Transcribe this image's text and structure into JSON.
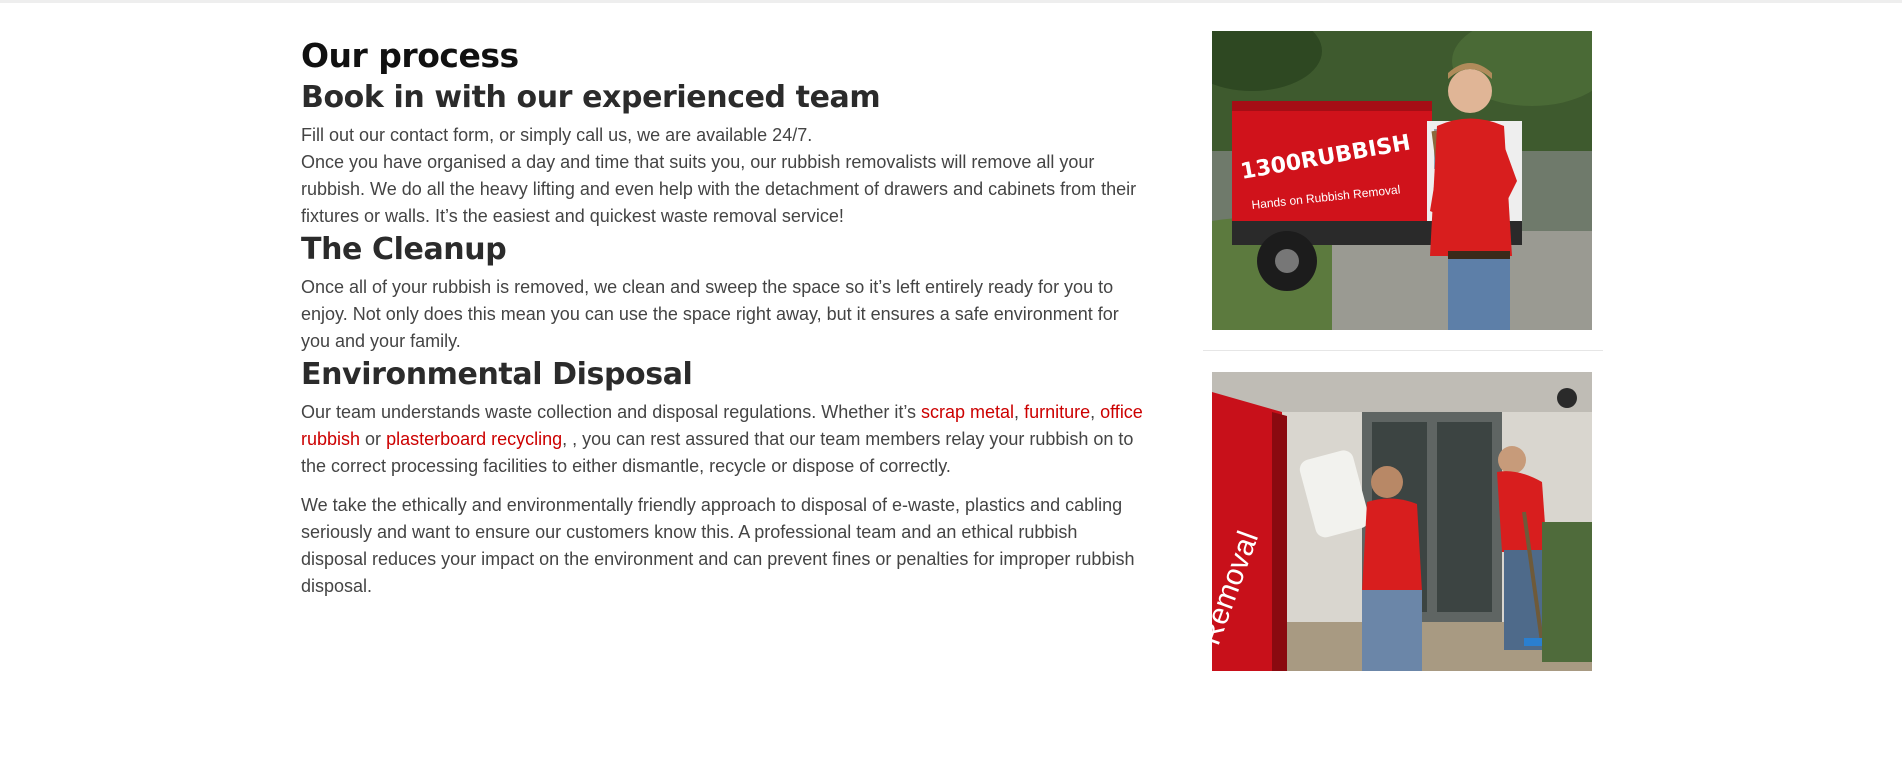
{
  "page": {
    "title": "Our process"
  },
  "sections": [
    {
      "heading": "Book in with our experienced team",
      "line1": "Fill out our contact form, or simply call us, we are available 24/7.",
      "line2": "Once you have organised a day and time that suits you, our rubbish removalists will remove all your rubbish. We do all the heavy lifting and even help with the detachment of drawers and cabinets from their fixtures or walls. It’s the easiest and quickest waste removal service!"
    },
    {
      "heading": "The Cleanup",
      "text": "Once all of your rubbish is removed, we clean and sweep the space so it’s left entirely ready for you to enjoy. Not only does this mean you can use the space right away, but it ensures a safe environment for you and your family."
    },
    {
      "heading": "Environmental Disposal",
      "p1": {
        "intro": "Our team understands waste collection and disposal regulations. Whether it’s ",
        "link_scrap_metal": "scrap metal",
        "sep1": ", ",
        "link_furniture": "furniture",
        "sep2": ", ",
        "link_office_rubbish": "office rubbish",
        "sep3": " or ",
        "link_plasterboard": "plasterboard recycling",
        "outro": ", , you can rest assured that our team members relay your rubbish on to the correct processing facilities to either dismantle, recycle or dispose of correctly."
      },
      "p2": "We take the ethically and environmentally friendly approach to disposal of e-waste, plastics and cabling seriously and want to ensure our customers know this. A professional team and an ethical rubbish disposal reduces your impact on the environment and can prevent fines or penalties for improper rubbish disposal."
    }
  ],
  "sidebar": {
    "photo1": {
      "truck_brand": "1300RUBBISH",
      "truck_slogan": "Hands on Rubbish Removal"
    },
    "photo2": {
      "truck_fragment": "Removal"
    }
  },
  "colors": {
    "link": "#cc0000",
    "brand_red": "#d0121b",
    "heading": "#2b2b2b",
    "body_text": "#444444"
  }
}
